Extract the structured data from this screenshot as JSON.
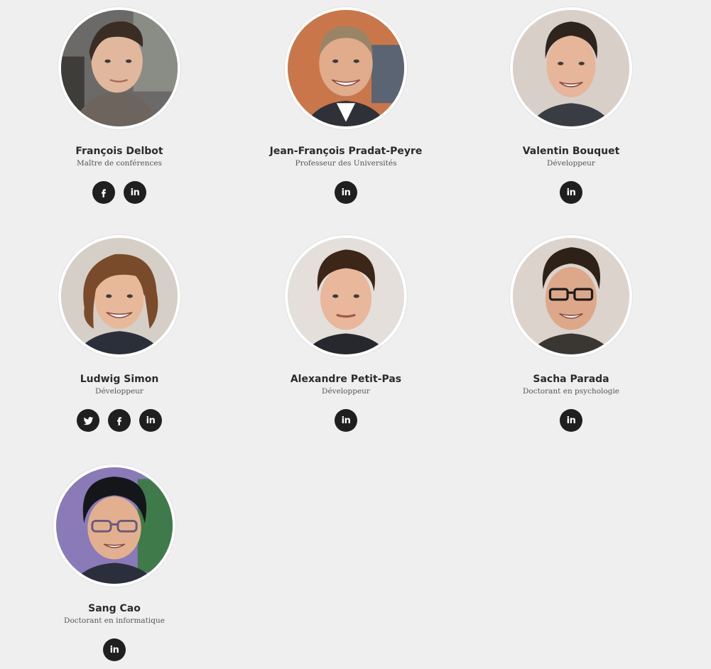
{
  "team": {
    "members": [
      {
        "name": "François Delbot",
        "role": "Maître de conférences",
        "socials": [
          "facebook-icon",
          "linkedin-icon"
        ],
        "linkedin_label": "in"
      },
      {
        "name": "Jean-François Pradat-Peyre",
        "role": "Professeur des Universités",
        "socials": [
          "linkedin-icon"
        ],
        "linkedin_label": "in"
      },
      {
        "name": "Valentin Bouquet",
        "role": "Développeur",
        "socials": [
          "linkedin-icon"
        ],
        "linkedin_label": "in"
      },
      {
        "name": "Ludwig Simon",
        "role": "Développeur",
        "socials": [
          "twitter-icon",
          "facebook-icon",
          "linkedin-icon"
        ],
        "linkedin_label": "in"
      },
      {
        "name": "Alexandre Petit-Pas",
        "role": "Développeur",
        "socials": [
          "linkedin-icon"
        ],
        "linkedin_label": "in"
      },
      {
        "name": "Sacha Parada",
        "role": "Doctorant en psychologie",
        "socials": [
          "linkedin-icon"
        ],
        "linkedin_label": "in"
      },
      {
        "name": "Sang Cao",
        "role": "Doctorant en informatique",
        "socials": [
          "linkedin-icon"
        ],
        "linkedin_label": "in"
      }
    ]
  },
  "colors": {
    "background": "#efefef",
    "icon_circle": "#1f1f1f",
    "name_text": "#2b2b2b",
    "role_text": "#555555"
  }
}
